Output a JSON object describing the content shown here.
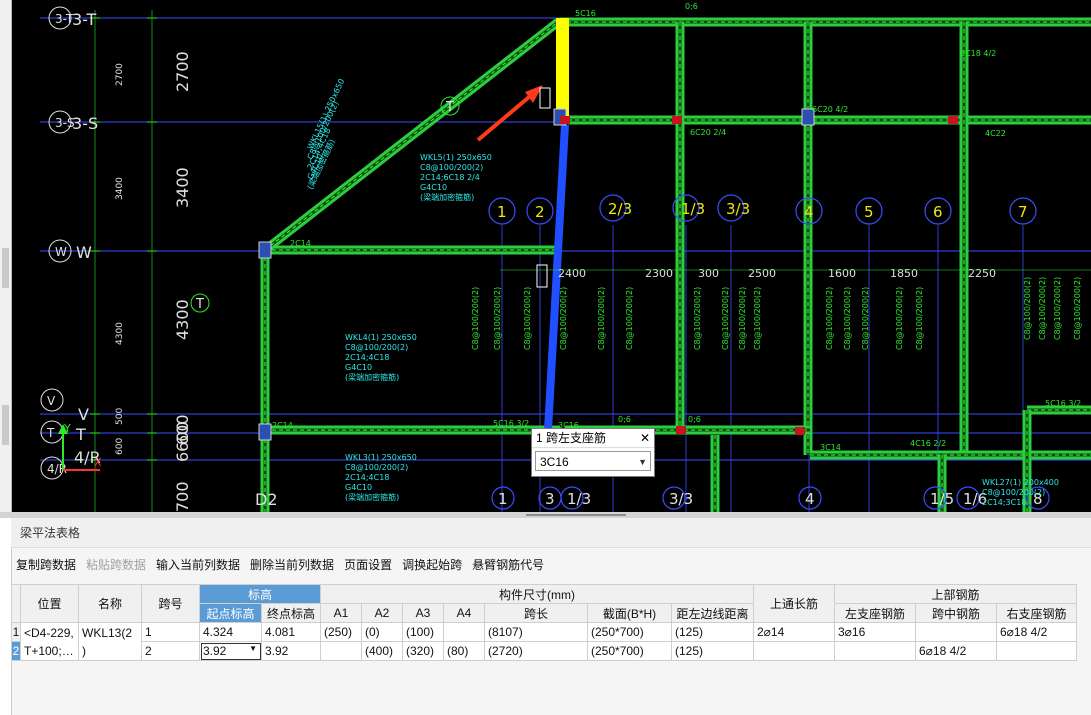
{
  "cad": {
    "axis_bubbles_left": [
      "3-T",
      "3-S",
      "W",
      "V",
      "T",
      "4/R"
    ],
    "axis_labels_left": [
      "3-T",
      "3-S",
      "W",
      "V",
      "T",
      "4/R"
    ],
    "dimensions_left": [
      "2700",
      "3400",
      "4300",
      "600",
      "700",
      "6600"
    ],
    "small_dims_left": [
      "2700",
      "3400",
      "4300",
      "500",
      "600"
    ],
    "axis_bubbles_top": [
      "1",
      "2",
      "2/3",
      "1/3",
      "3/3",
      "4",
      "5",
      "6",
      "7"
    ],
    "axis_bubbles_bottom": [
      "1",
      "3",
      "1/3",
      "3/3",
      "4",
      "1/5",
      "1/6",
      "8"
    ],
    "bottom_label_d2": "D2",
    "span_dims": [
      "2400",
      "2300",
      "300",
      "2500",
      "1600",
      "1850",
      "2250"
    ],
    "rebar_labels": [
      "5C16",
      "0;6",
      "6C20 4/2",
      "6C18 4/2",
      "6C20 2/4",
      "4C22",
      "5C16 3/2",
      "0;6",
      "0;6",
      "4C16 2/2",
      "3C14",
      "2C14",
      "5C16 3/2",
      "3C16",
      "2C14"
    ],
    "beam_notes": [
      {
        "title": "WKL15(1) 250x650",
        "lines": [
          "C8@100/200(2)",
          "2C14;4C18",
          "G4C10",
          "(梁端加密箍筋)"
        ]
      },
      {
        "title": "WKL5(1) 250x650",
        "lines": [
          "C8@100/200(2)",
          "2C14;6C18 2/4",
          "G4C10",
          "(梁端加密箍筋)"
        ]
      },
      {
        "title": "WKL4(1) 250x650",
        "lines": [
          "C8@100/200(2)",
          "2C14;4C18",
          "G4C10",
          "(梁端加密箍筋)"
        ]
      },
      {
        "title": "WKL3(1) 250x650",
        "lines": [
          "C8@100/200(2)",
          "2C14;4C18",
          "G4C10",
          "(梁端加密箍筋)"
        ]
      },
      {
        "title": "WKL27(1) 200x400",
        "lines": [
          "C8@100/200(2)",
          "2C14;3C18"
        ]
      }
    ],
    "marker_T": "T"
  },
  "popup": {
    "title": "1 跨左支座筋",
    "close": "✕",
    "value": "3C16"
  },
  "panel": {
    "title": "梁平法表格",
    "toolbar": [
      "复制跨数据",
      "粘贴跨数据",
      "输入当前列数据",
      "删除当前列数据",
      "页面设置",
      "调换起始跨",
      "悬臂钢筋代号"
    ],
    "toolbar_disabled": [
      false,
      true,
      false,
      false,
      false,
      false,
      false
    ],
    "headers": {
      "position": "位置",
      "name": "名称",
      "span_no": "跨号",
      "elevation": "标高",
      "start_elev": "起点标高",
      "end_elev": "终点标高",
      "member_size": "构件尺寸(mm)",
      "a1": "A1",
      "a2": "A2",
      "a3": "A3",
      "a4": "A4",
      "span_len": "跨长",
      "section": "截面(B*H)",
      "edge_dist": "距左边线距离",
      "top_through": "上通长筋",
      "top_rebar": "上部钢筋",
      "left_support": "左支座钢筋",
      "mid_span": "跨中钢筋",
      "right_support": "右支座钢筋"
    },
    "rows": [
      {
        "rn": "1",
        "position": "<D4-229,",
        "name": "WKL13(2",
        "span": "1",
        "start": "4.324",
        "end": "4.081",
        "a1": "(250)",
        "a2": "(0)",
        "a3": "(100)",
        "a4": "",
        "len": "(8107)",
        "sec": "(250*700)",
        "edge": "(125)",
        "through": "2⌀14",
        "left": "3⌀16",
        "mid": "",
        "right": "6⌀18 4/2"
      },
      {
        "rn": "2",
        "position": "T+100;…",
        "name": ")",
        "span": "2",
        "start": "3.92",
        "end": "3.92",
        "a1": "",
        "a2": "(400)",
        "a3": "(320)",
        "a4": "(80)",
        "len": "(2720)",
        "sec": "(250*700)",
        "edge": "(125)",
        "through": "",
        "left": "",
        "mid": "6⌀18 4/2",
        "right": ""
      }
    ]
  },
  "colors": {
    "beam_green": "#2ecc40",
    "grid_blue": "#1f5bff",
    "selected_beam_blue": "#1f4fff",
    "highlight_yellow": "#ffff00",
    "arrow_red": "#ff3a1a",
    "text_green": "#2ee82e",
    "text_white": "#e0e0e0",
    "header_blue": "#5b9bd5"
  }
}
